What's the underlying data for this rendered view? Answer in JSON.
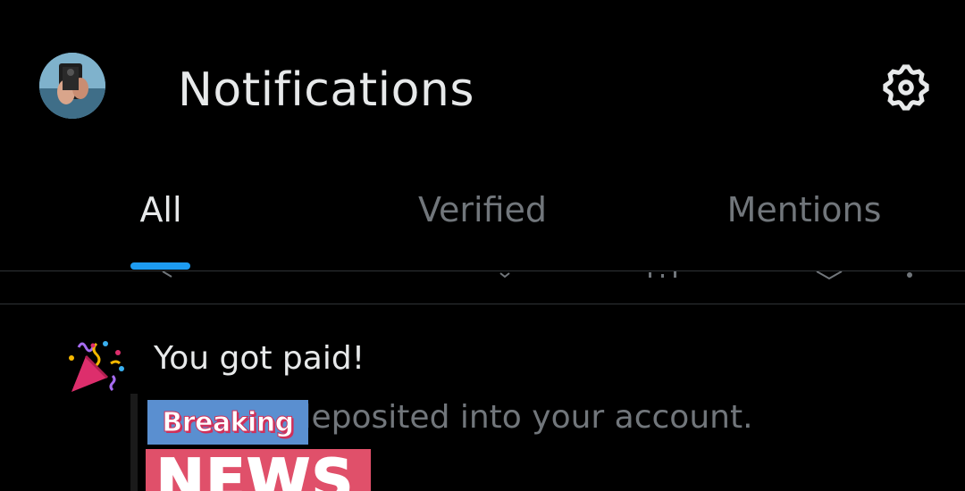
{
  "header": {
    "title": "Notifications",
    "avatar_icon": "profile-photo",
    "settings_icon": "gear-icon"
  },
  "tabs": [
    {
      "label": "All",
      "selected": true
    },
    {
      "label": "Verified",
      "selected": false
    },
    {
      "label": "Mentions",
      "selected": false
    }
  ],
  "notification": {
    "icon": "party-popper-icon",
    "title": "You got paid!",
    "body": "as been deposited into your account."
  },
  "overlay": {
    "breaking_label": "Breaking",
    "news_label": "NEWS"
  },
  "colors": {
    "background": "#000000",
    "primary_text": "#e7e9ea",
    "secondary_text": "#71767b",
    "accent": "#1d9bf0",
    "divider": "#2f3336"
  }
}
